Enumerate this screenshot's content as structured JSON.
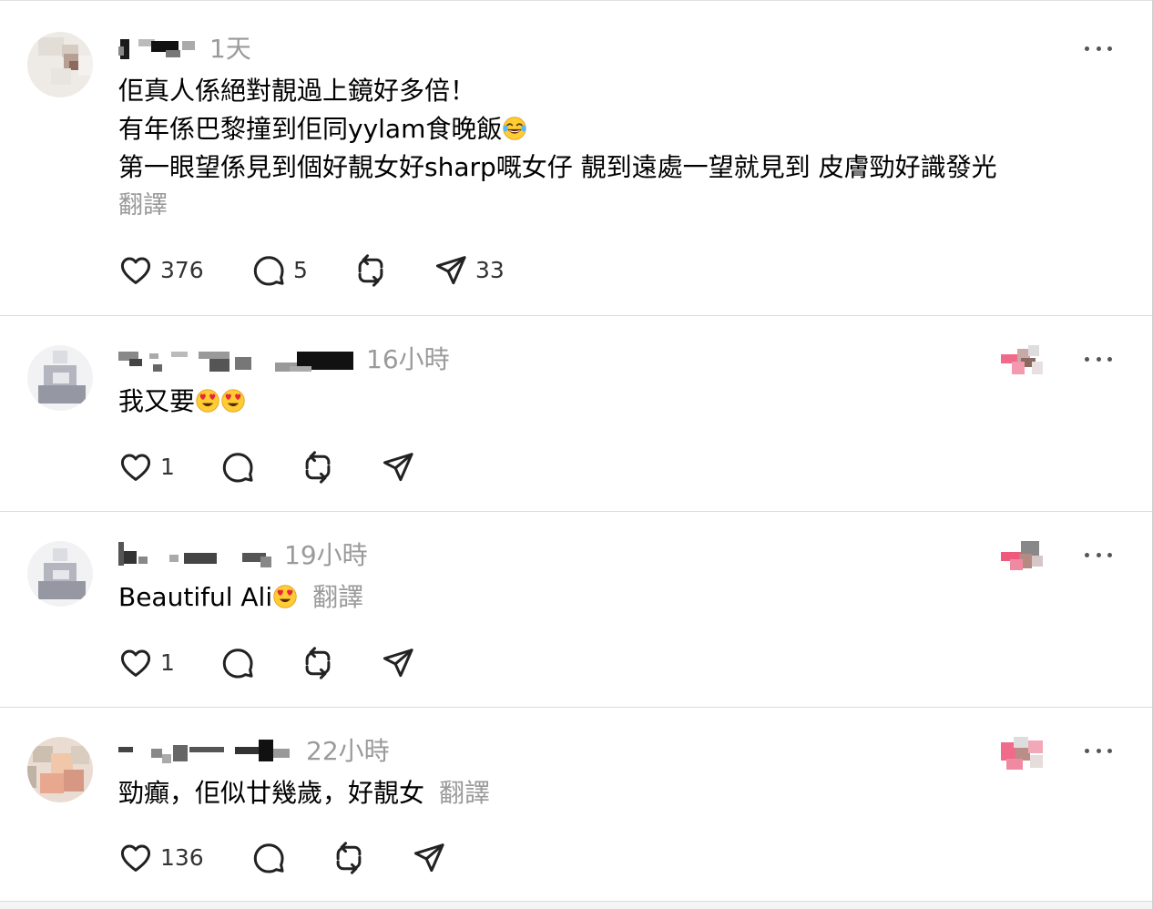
{
  "posts": [
    {
      "timestamp": "1天",
      "lines": [
        "佢真人係絕對靚過上鏡好多倍！",
        "有年係巴黎撞到佢同yylam食晚飯",
        "第一眼望係見到個好靚女好sharp嘅女仔 靚到遠處一望就見到 皮膚勁好識發光"
      ],
      "translate_label": "翻譯",
      "likes": "376",
      "replies": "5",
      "shares": "33"
    },
    {
      "timestamp": "16小時",
      "text": "我又要",
      "likes": "1"
    },
    {
      "timestamp": "19小時",
      "text": "Beautiful Ali",
      "translate_label": "翻譯",
      "likes": "1"
    },
    {
      "timestamp": "22小時",
      "text": "勁癲，佢似廿幾歲，好靚女",
      "translate_label": "翻譯",
      "likes": "136"
    }
  ],
  "icons": {
    "like": "heart-icon",
    "reply": "comment-icon",
    "repost": "repost-icon",
    "share": "send-icon",
    "more": "more-horizontal-icon",
    "laugh_emoji": "tears-of-joy-emoji",
    "love_emoji": "heart-eyes-emoji"
  },
  "colors": {
    "timestamp": "#9a9a9a",
    "translate": "#9a9a9a",
    "divider": "#dcdcdc",
    "icon": "#222222"
  }
}
